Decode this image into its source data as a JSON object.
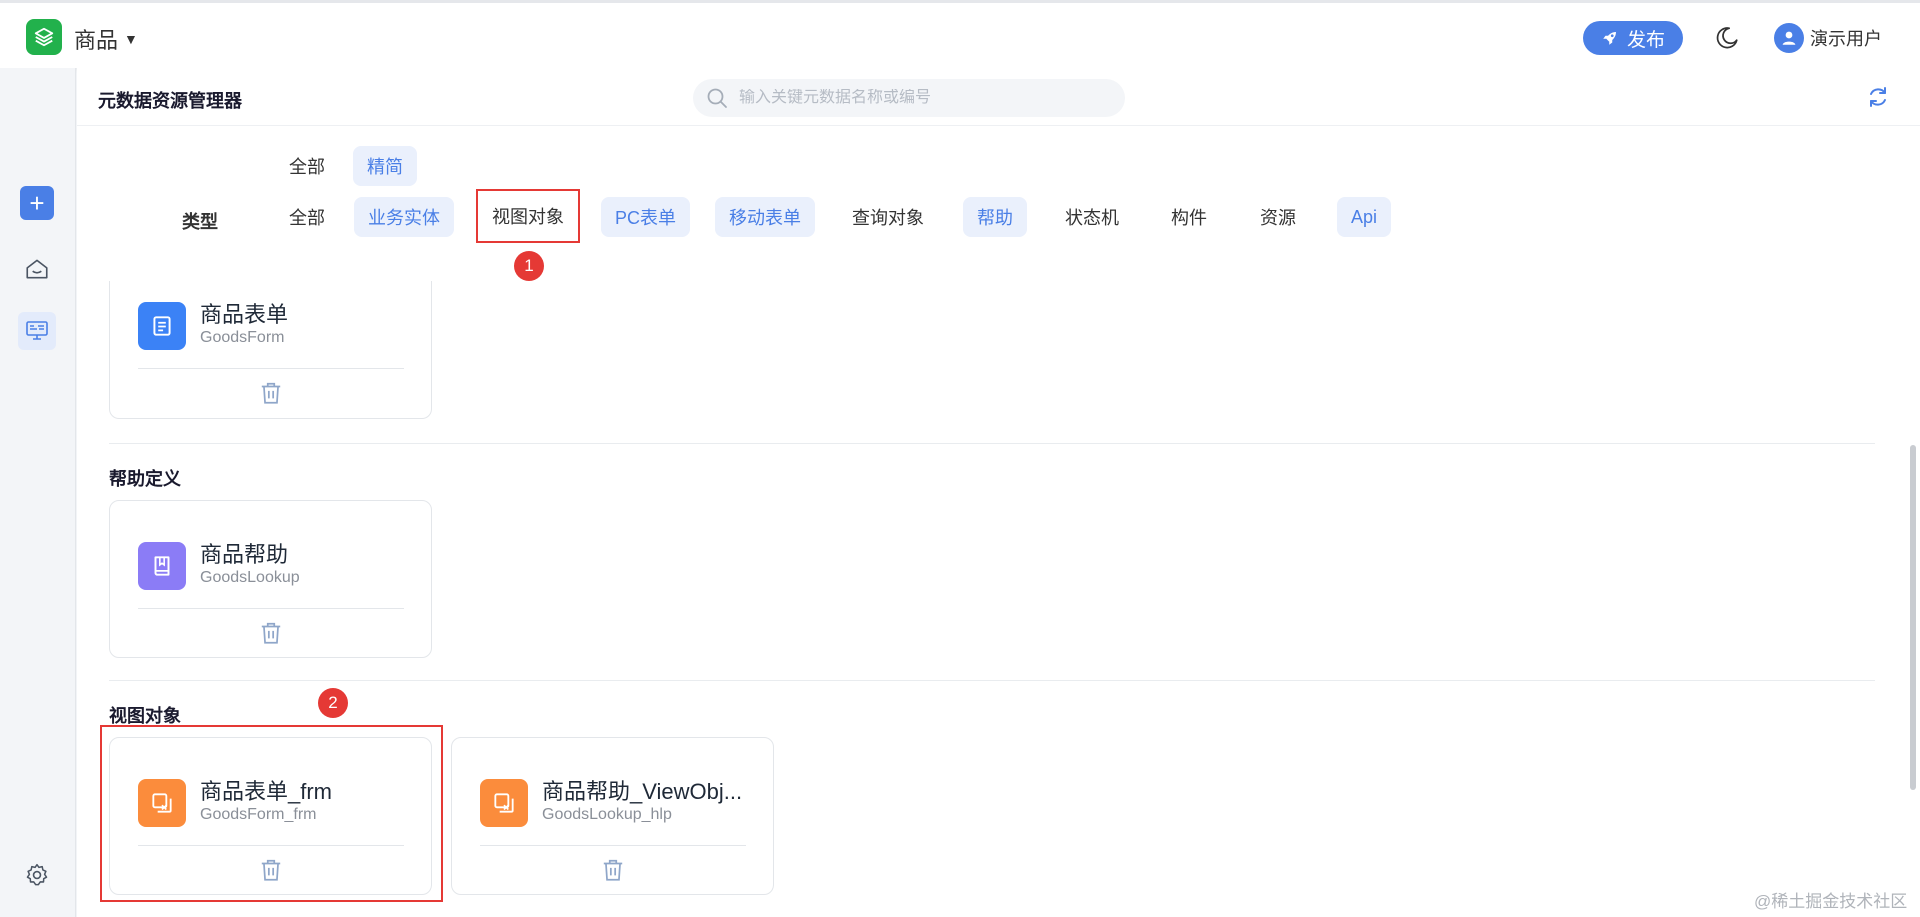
{
  "topbar": {
    "app_title": "商品",
    "publish_label": "发布",
    "user_name": "演示用户"
  },
  "main": {
    "title": "元数据资源管理器",
    "search_placeholder": "输入关键元数据名称或编号"
  },
  "filters": {
    "scope_options": [
      "全部",
      "精简"
    ],
    "scope_selected": "精简",
    "type_label": "类型",
    "type_options": [
      "全部",
      "业务实体",
      "视图对象",
      "PC表单",
      "移动表单",
      "查询对象",
      "帮助",
      "状态机",
      "构件",
      "资源",
      "Api"
    ]
  },
  "annotations": {
    "badge1": "1",
    "badge2": "2"
  },
  "sections": [
    {
      "title": "",
      "cards": [
        {
          "name": "商品表单",
          "code": "GoodsForm",
          "icon": "form-icon",
          "color": "#3b82f6"
        }
      ]
    },
    {
      "title": "帮助定义",
      "cards": [
        {
          "name": "商品帮助",
          "code": "GoodsLookup",
          "icon": "book-icon",
          "color": "#8b7cf6"
        }
      ]
    },
    {
      "title": "视图对象",
      "cards": [
        {
          "name": "商品表单_frm",
          "code": "GoodsForm_frm",
          "icon": "view-object-icon",
          "color": "#fb8c3c"
        },
        {
          "name": "商品帮助_ViewObj...",
          "code": "GoodsLookup_hlp",
          "icon": "view-object-icon",
          "color": "#fb8c3c"
        }
      ]
    }
  ],
  "watermark": "@稀土掘金技术社区",
  "colors": {
    "accent": "#4a7fe6",
    "annotation": "#e53935",
    "app_green": "#22b14c"
  }
}
